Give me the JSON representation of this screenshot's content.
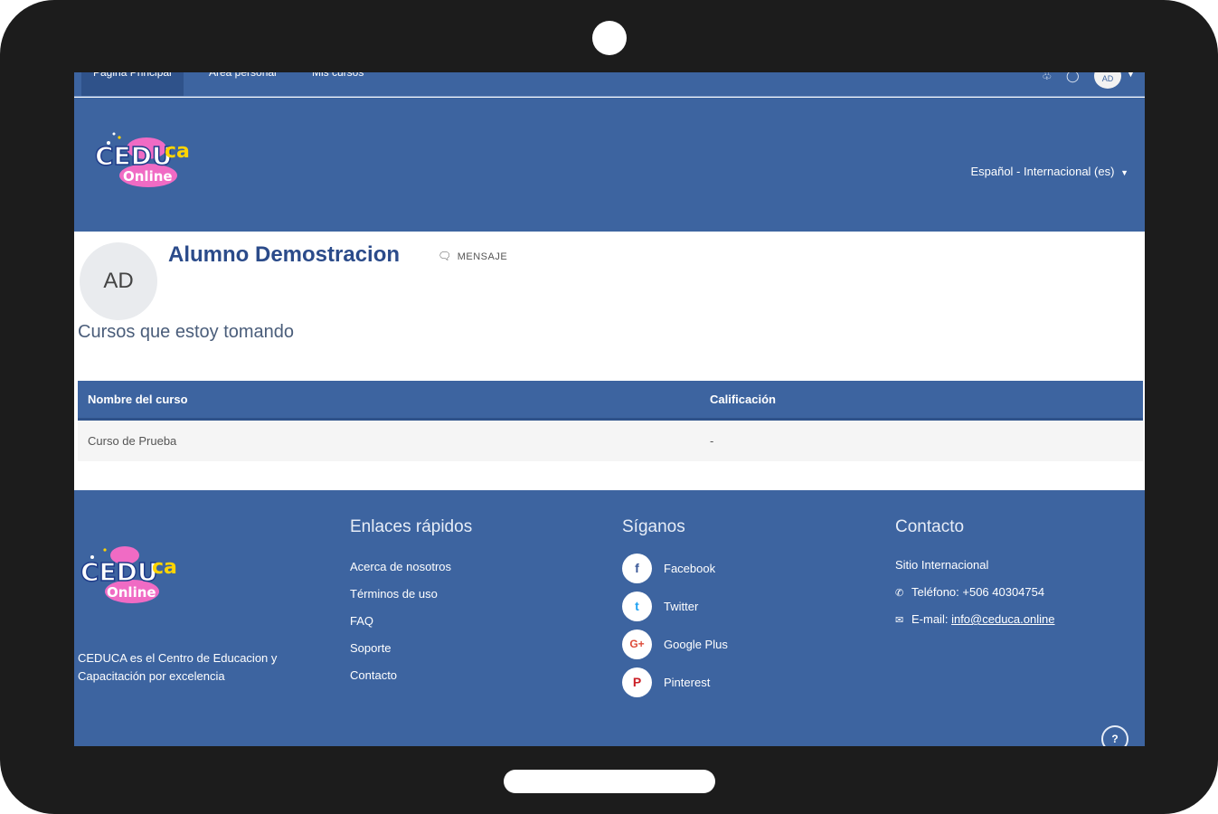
{
  "nav": {
    "items": [
      "Página Principal",
      "Área personal",
      "Mis cursos"
    ],
    "avatar_initials": "AD"
  },
  "header": {
    "logo_text_main": "CEDU",
    "logo_text_accent": "ca",
    "logo_badge": "Online",
    "language": "Español - Internacional (es)"
  },
  "profile": {
    "initials": "AD",
    "name": "Alumno Demostracion",
    "message_label": "MENSAJE",
    "section_title": "Cursos que estoy tomando"
  },
  "courses": {
    "headers": [
      "Nombre del curso",
      "Calificación"
    ],
    "rows": [
      [
        "Curso de Prueba",
        "-"
      ]
    ]
  },
  "footer": {
    "about": "CEDUCA es el Centro de Educacion y Capacitación por excelencia",
    "quick_links_title": "Enlaces rápidos",
    "quick_links": [
      "Acerca de nosotros",
      "Términos de uso",
      "FAQ",
      "Soporte",
      "Contacto"
    ],
    "follow_title": "Síganos",
    "social": [
      {
        "label": "Facebook",
        "icon": "facebook-icon",
        "glyph": "f",
        "color": "#3b5998"
      },
      {
        "label": "Twitter",
        "icon": "twitter-icon",
        "glyph": "t",
        "color": "#1da1f2"
      },
      {
        "label": "Google Plus",
        "icon": "google-plus-icon",
        "glyph": "G+",
        "color": "#dd4b39"
      },
      {
        "label": "Pinterest",
        "icon": "pinterest-icon",
        "glyph": "P",
        "color": "#cb2027"
      }
    ],
    "contact_title": "Contacto",
    "contact_site": "Sitio Internacional",
    "contact_phone": "Teléfono: +506 40304754",
    "contact_email_label": "E-mail:",
    "contact_email": "info@ceduca.online",
    "help": "?"
  },
  "colors": {
    "brand_blue": "#3d64a0",
    "name_blue": "#2b4b8a",
    "logo_pink": "#f06bc4",
    "logo_yellow": "#ffd400"
  }
}
